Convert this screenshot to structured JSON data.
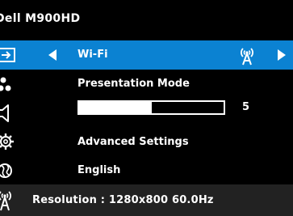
{
  "header": {
    "title": "Dell  M900HD"
  },
  "menu": {
    "wifi": {
      "label": "Wi-Fi",
      "icon": "wifi-icon"
    },
    "presentation_mode": {
      "label": "Presentation Mode",
      "icon": "presentation-icon"
    },
    "volume": {
      "value": "5",
      "level_fraction": 0.5,
      "icon": "speaker-icon"
    },
    "advanced_settings": {
      "label": "Advanced Settings",
      "icon": "gear-icon"
    },
    "language": {
      "label": "English",
      "icon": "globe-icon"
    }
  },
  "status": {
    "resolution": "Resolution :  1280x800 60.0Hz",
    "icon": "wifi-icon"
  },
  "colors": {
    "selected_row": "#0b82d2",
    "background": "#000000",
    "status_bar": "#222222"
  }
}
